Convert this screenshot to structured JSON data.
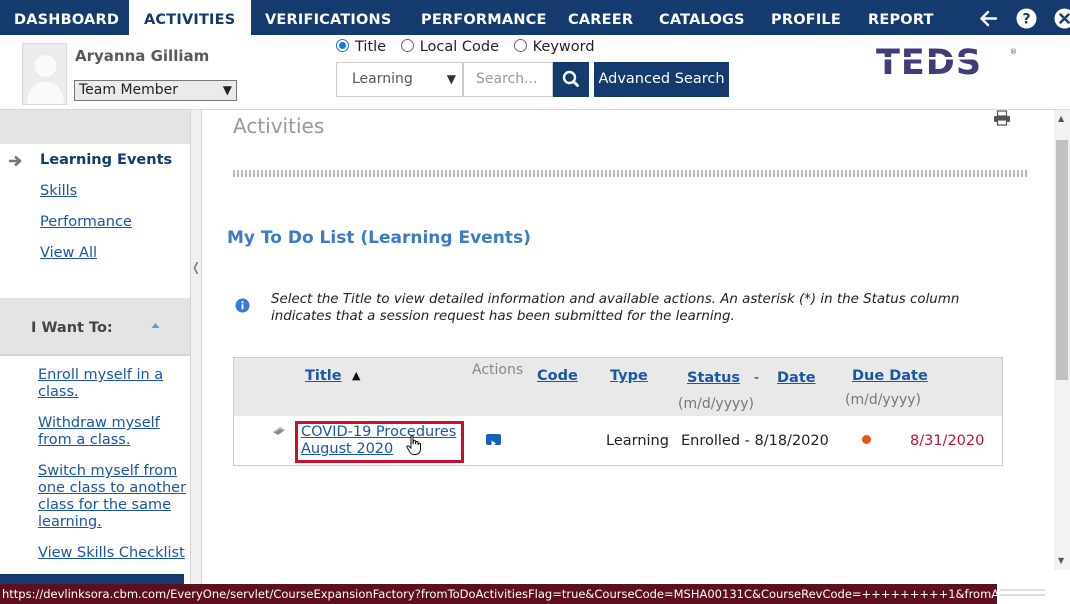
{
  "nav": {
    "items": [
      "DASHBOARD",
      "ACTIVITIES",
      "VERIFICATIONS",
      "PERFORMANCE",
      "CAREER",
      "CATALOGS",
      "PROFILE",
      "REPORT"
    ],
    "active": "ACTIVITIES",
    "icons": [
      "back-arrow-icon",
      "help-icon",
      "close-icon"
    ]
  },
  "user": {
    "name": "Aryanna Gilliam",
    "role": "Team Member"
  },
  "search": {
    "options": [
      "Title",
      "Local Code",
      "Keyword"
    ],
    "selected_option": "Title",
    "type_value": "Learning",
    "placeholder": "Search...",
    "advanced_label": "Advanced Search"
  },
  "logo": {
    "text": "TEDS"
  },
  "sidebar": {
    "items": [
      "Learning Events",
      "Skills",
      "Performance",
      "View All"
    ],
    "active": "Learning Events",
    "i_want_label": "I Want To:",
    "want_links": [
      "Enroll myself in a class.",
      "Withdraw myself from a class.",
      "Switch myself from one class to another class for the same learning.",
      "View Skills Checklist"
    ]
  },
  "main": {
    "page_title": "Activities",
    "section_title": "My To Do List (Learning Events)",
    "info_text": "Select the Title to view detailed information and available actions. An asterisk (*) in the Status column indicates that a session request has been submitted for the learning.",
    "table": {
      "headers": {
        "title": "Title",
        "sort_indicator": "▲",
        "actions": "Actions",
        "code": "Code",
        "type": "Type",
        "status": "Status",
        "dash": "-",
        "date": "Date",
        "date_format": "(m/d/yyyy)",
        "due_date": "Due Date",
        "due_format": "(m/d/yyyy)"
      },
      "rows": [
        {
          "title": "COVID-19 Procedures August 2020",
          "title_line1": "COVID-19 Procedures",
          "title_line2": "August 2020",
          "code": "",
          "type": "Learning",
          "status": "Enrolled - 8/18/2020",
          "due_date": "8/31/2020",
          "due_color": "#c8102e"
        }
      ]
    }
  },
  "status_bar": {
    "url": "https://devlinksora.cbm.com/EveryOne/servlet/CourseExpansionFactory?fromToDoActivitiesFlag=true&CourseCode=MSHA00131C&CourseRevCode=+++++++++1&fromActivities=true"
  },
  "colors": {
    "nav_bg": "#143a6e",
    "link": "#1a56a6",
    "section_title": "#3a7cc6",
    "highlight": "#c8102e",
    "status_bar": "#5e0f1f"
  }
}
